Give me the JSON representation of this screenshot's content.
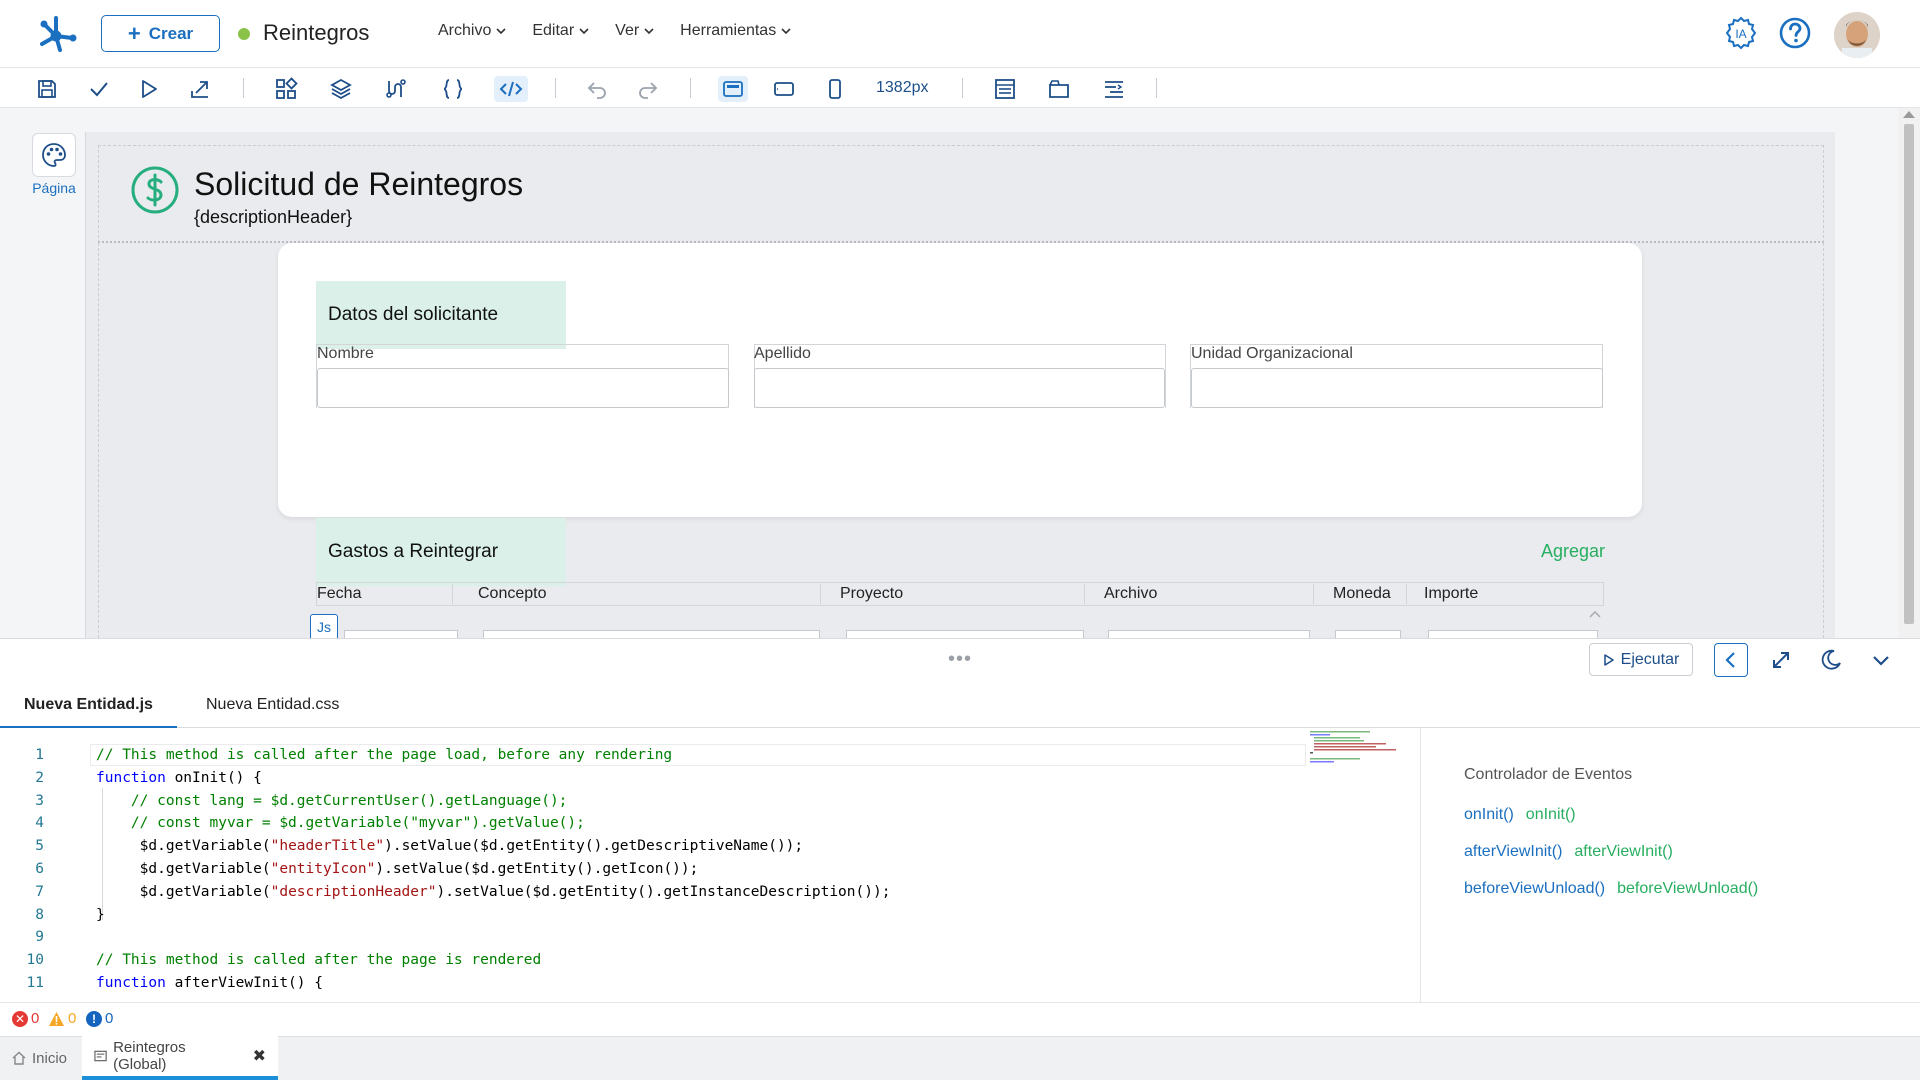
{
  "topbar": {
    "create_label": "Crear",
    "app_title": "Reintegros",
    "menu": [
      {
        "label": "Archivo"
      },
      {
        "label": "Editar"
      },
      {
        "label": "Ver"
      },
      {
        "label": "Herramientas"
      }
    ],
    "ia_label": "IA",
    "colors": {
      "accent": "#1b6fc0",
      "status_dot": "#8bc34a"
    }
  },
  "toolbar": {
    "width_label": "1382px",
    "icons": [
      "save-icon",
      "check-icon",
      "play-icon",
      "export-icon",
      "components-icon",
      "layers-icon",
      "variables-icon",
      "braces-icon",
      "code-icon",
      "undo-icon",
      "redo-icon",
      "desktop-view-icon",
      "tablet-view-icon",
      "mobile-view-icon",
      "layout-icon",
      "window-icon",
      "align-icon"
    ]
  },
  "sidebar": {
    "page_label": "Página"
  },
  "canvas": {
    "title": "Solicitud de Reintegros",
    "description": "{descriptionHeader}",
    "section1": {
      "title": "Datos del solicitante",
      "fields": [
        {
          "label": "Nombre",
          "value": ""
        },
        {
          "label": "Apellido",
          "value": ""
        },
        {
          "label": "Unidad Organizacional",
          "value": ""
        }
      ]
    },
    "section2": {
      "title": "Gastos a Reintegrar",
      "add_label": "Agregar",
      "columns": [
        "Fecha",
        "Concepto",
        "Proyecto",
        "Archivo",
        "Moneda",
        "Importe"
      ]
    },
    "js_badge": "Js"
  },
  "editor": {
    "run_label": "Ejecutar",
    "tabs": [
      {
        "label": "Nueva Entidad.js",
        "active": true
      },
      {
        "label": "Nueva Entidad.css",
        "active": false
      }
    ],
    "code_lines": [
      {
        "n": "1",
        "text": "// This method is called after the page load, before any rendering",
        "kind": "comment"
      },
      {
        "n": "2",
        "text": "function onInit() {",
        "kind": "keyword"
      },
      {
        "n": "3",
        "text": "    // const lang = $d.getCurrentUser().getLanguage();",
        "kind": "comment"
      },
      {
        "n": "4",
        "text": "    // const myvar = $d.getVariable(\"myvar\").getValue();",
        "kind": "comment"
      },
      {
        "n": "5",
        "text": "     $d.getVariable(\"headerTitle\").setValue($d.getEntity().getDescriptiveName());",
        "kind": "code"
      },
      {
        "n": "6",
        "text": "     $d.getVariable(\"entityIcon\").setValue($d.getEntity().getIcon());",
        "kind": "code"
      },
      {
        "n": "7",
        "text": "     $d.getVariable(\"descriptionHeader\").setValue($d.getEntity().getInstanceDescription());",
        "kind": "code"
      },
      {
        "n": "8",
        "text": "}",
        "kind": "plain"
      },
      {
        "n": "9",
        "text": "",
        "kind": "plain"
      },
      {
        "n": "10",
        "text": "// This method is called after the page is rendered",
        "kind": "comment"
      },
      {
        "n": "11",
        "text": "function afterViewInit() {",
        "kind": "keyword"
      }
    ],
    "events": {
      "title": "Controlador de Eventos",
      "items": [
        {
          "handler": "onInit()",
          "target": "onInit()"
        },
        {
          "handler": "afterViewInit()",
          "target": "afterViewInit()"
        },
        {
          "handler": "beforeViewUnload()",
          "target": "beforeViewUnload()"
        }
      ]
    }
  },
  "status": {
    "errors": "0",
    "warnings": "0",
    "infos": "0"
  },
  "bottom_tabs": [
    {
      "label": "Inicio",
      "active": false
    },
    {
      "label": "Reintegros (Global)",
      "active": true
    }
  ]
}
